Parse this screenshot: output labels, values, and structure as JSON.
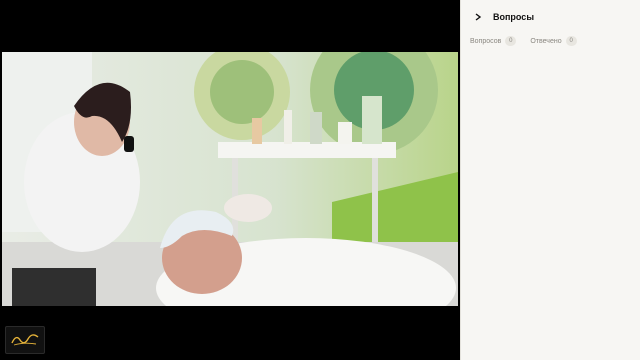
{
  "panel": {
    "title": "Вопросы",
    "tabs": [
      {
        "label": "Вопросов",
        "count": "0"
      },
      {
        "label": "Отвечено",
        "count": "0"
      }
    ]
  },
  "video": {
    "logo_icon": "brand-signature-logo"
  },
  "colors": {
    "background": "#000000",
    "panel_bg": "#f7f6f3",
    "text_primary": "#111111",
    "text_muted": "#8a8780"
  }
}
